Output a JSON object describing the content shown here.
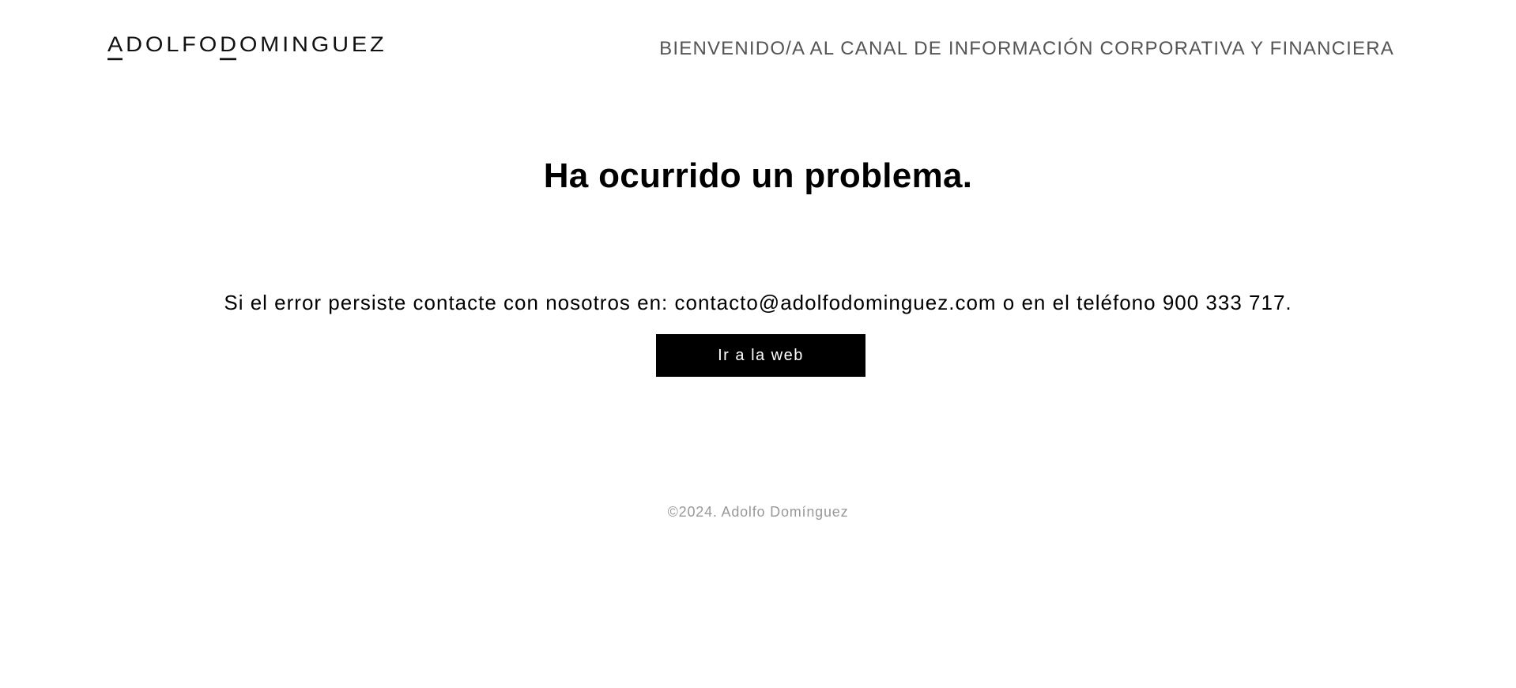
{
  "header": {
    "logo_parts": [
      "A",
      "DOLFO",
      "D",
      "OMINGUEZ"
    ],
    "logo_text": "ADOLFODOMINGUEZ",
    "tagline": "BIENVENIDO/A AL CANAL DE INFORMACIÓN CORPORATIVA Y FINANCIERA"
  },
  "main": {
    "title": "Ha ocurrido un problema.",
    "message": "Si el error persiste contacte con nosotros en: contacto@adolfodominguez.com o en el teléfono 900 333 717.",
    "button_label": "Ir a la web"
  },
  "footer": {
    "copyright": "©2024. Adolfo Domínguez"
  },
  "colors": {
    "text": "#000000",
    "tagline": "#555555",
    "footer": "#999999",
    "button_bg": "#000000",
    "button_text": "#ffffff",
    "background": "#ffffff"
  }
}
